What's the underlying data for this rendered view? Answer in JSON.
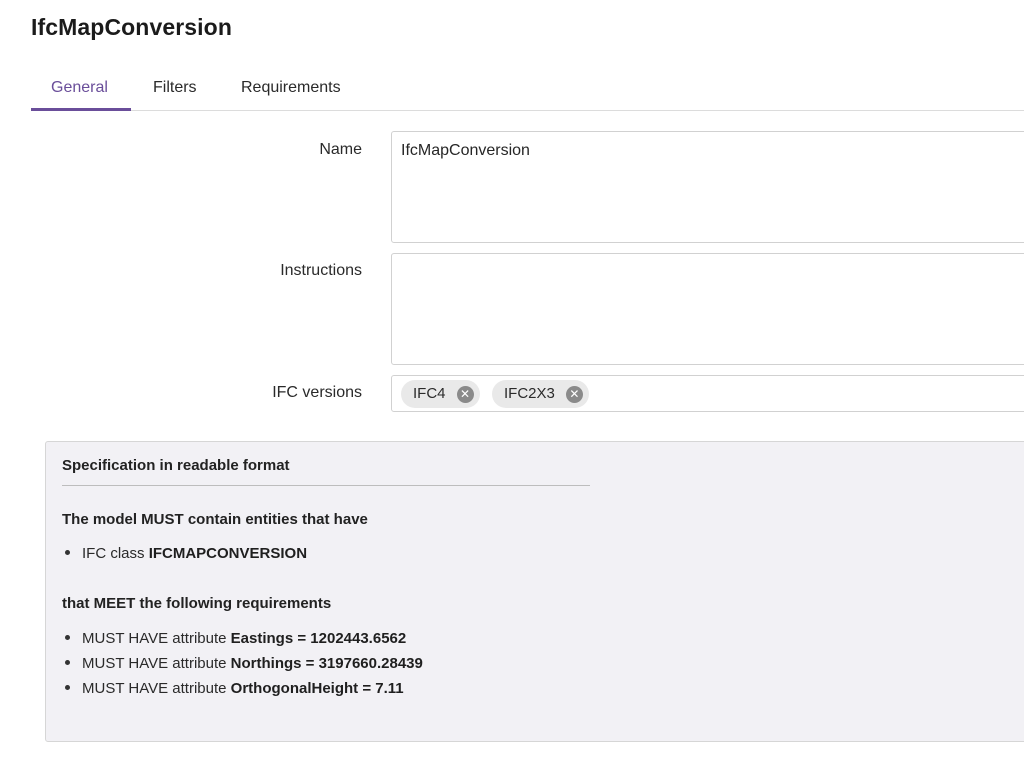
{
  "page_title": "IfcMapConversion",
  "tabs": [
    {
      "label": "General",
      "active": true
    },
    {
      "label": "Filters",
      "active": false
    },
    {
      "label": "Requirements",
      "active": false
    }
  ],
  "form": {
    "name_label": "Name",
    "name_value": "IfcMapConversion",
    "instructions_label": "Instructions",
    "instructions_value": "",
    "ifc_versions_label": "IFC versions",
    "ifc_versions": [
      "IFC4",
      "IFC2X3"
    ]
  },
  "spec": {
    "title": "Specification in readable format",
    "applicability_heading": "The model MUST contain entities that have",
    "applicability_items": [
      {
        "prefix": "IFC class ",
        "bold": "IFCMAPCONVERSION"
      }
    ],
    "requirements_heading": "that MEET the following requirements",
    "requirement_items": [
      {
        "prefix": "MUST HAVE attribute ",
        "bold": "Eastings = 1202443.6562"
      },
      {
        "prefix": "MUST HAVE attribute ",
        "bold": "Northings = 3197660.28439"
      },
      {
        "prefix": "MUST HAVE attribute ",
        "bold": "OrthogonalHeight = 7.11"
      }
    ]
  },
  "colors": {
    "accent": "#6a4e9a",
    "panel_bg": "#f2f1f5"
  }
}
